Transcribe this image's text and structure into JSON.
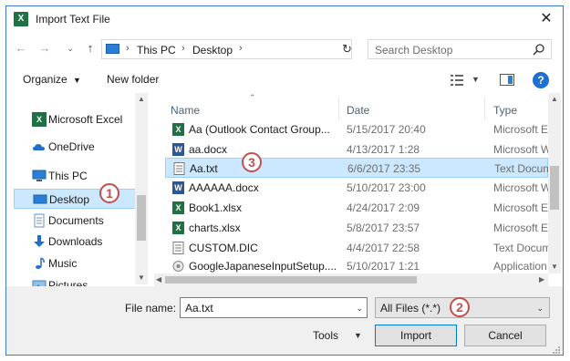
{
  "window": {
    "title": "Import Text File",
    "app_icon": "X"
  },
  "address_bar": {
    "crumbs": [
      "This PC",
      "Desktop"
    ]
  },
  "search": {
    "placeholder": "Search Desktop"
  },
  "toolbar": {
    "organize": "Organize",
    "new_folder": "New folder",
    "help": "?"
  },
  "sidebar": {
    "items": [
      {
        "label": "Microsoft Excel",
        "icon": "excel-icon"
      },
      {
        "label": "OneDrive",
        "icon": "cloud-icon"
      },
      {
        "label": "This PC",
        "icon": "computer-icon"
      },
      {
        "label": "Desktop",
        "icon": "desktop-icon"
      },
      {
        "label": "Documents",
        "icon": "documents-icon"
      },
      {
        "label": "Downloads",
        "icon": "download-icon"
      },
      {
        "label": "Music",
        "icon": "music-icon"
      },
      {
        "label": "Pictures",
        "icon": "pictures-icon"
      }
    ]
  },
  "columns": {
    "name": "Name",
    "date": "Date",
    "type": "Type"
  },
  "files": [
    {
      "name": "Aa (Outlook Contact Group...",
      "date": "5/15/2017 20:40",
      "type": "Microsoft Excel",
      "icon": "excel"
    },
    {
      "name": "aa.docx",
      "date": "4/13/2017 1:28",
      "type": "Microsoft Word",
      "icon": "word"
    },
    {
      "name": "Aa.txt",
      "date": "6/6/2017 23:35",
      "type": "Text Document",
      "icon": "text"
    },
    {
      "name": "AAAAAA.docx",
      "date": "5/10/2017 23:00",
      "type": "Microsoft Word",
      "icon": "word"
    },
    {
      "name": "Book1.xlsx",
      "date": "4/24/2017 2:09",
      "type": "Microsoft Excel",
      "icon": "excel"
    },
    {
      "name": "charts.xlsx",
      "date": "5/8/2017 23:57",
      "type": "Microsoft Excel",
      "icon": "excel"
    },
    {
      "name": "CUSTOM.DIC",
      "date": "4/4/2017 22:58",
      "type": "Text Document",
      "icon": "text"
    },
    {
      "name": "GoogleJapaneseInputSetup....",
      "date": "5/10/2017 1:21",
      "type": "Application",
      "icon": "app"
    }
  ],
  "footer": {
    "file_name_label": "File name:",
    "file_name_value": "Aa.txt",
    "filter_value": "All Files (*.*)",
    "tools_label": "Tools",
    "import_label": "Import",
    "cancel_label": "Cancel"
  },
  "callouts": {
    "one": "1",
    "two": "2",
    "three": "3"
  },
  "colors": {
    "accent": "#0078d7",
    "selected_bg": "#cce8ff",
    "callout": "#c0504d"
  }
}
